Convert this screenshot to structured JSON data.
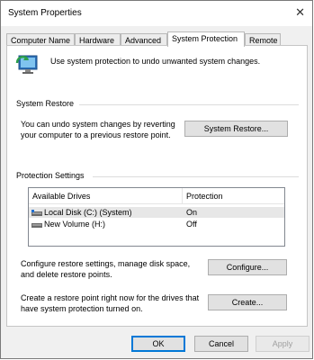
{
  "window": {
    "title": "System Properties",
    "close_glyph": "✕"
  },
  "tabs": [
    "Computer Name",
    "Hardware",
    "Advanced",
    "System Protection",
    "Remote"
  ],
  "intro_text": "Use system protection to undo unwanted system changes.",
  "system_restore": {
    "group_title": "System Restore",
    "line1": "You can undo system changes by reverting",
    "line2": "your computer to a previous restore point.",
    "button": "System Restore..."
  },
  "protection": {
    "group_title": "Protection Settings",
    "columns": [
      "Available Drives",
      "Protection"
    ],
    "drives": [
      {
        "name": "Local Disk (C:) (System)",
        "protection": "On",
        "icon": "system-drive-icon"
      },
      {
        "name": "New Volume (H:)",
        "protection": "Off",
        "icon": "drive-icon"
      }
    ],
    "configure_line1": "Configure restore settings, manage disk space,",
    "configure_line2": "and delete restore points.",
    "configure_button": "Configure...",
    "create_line1": "Create a restore point right now for the drives that",
    "create_line2": "have system protection turned on.",
    "create_button": "Create..."
  },
  "footer": {
    "ok": "OK",
    "cancel": "Cancel",
    "apply": "Apply"
  },
  "colors": {
    "accent": "#0078d7",
    "dialog_bg": "#f0f0f0",
    "selected_row": "#e7e7e7"
  }
}
